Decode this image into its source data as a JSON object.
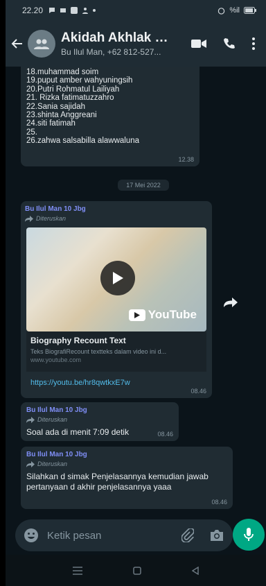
{
  "status_bar": {
    "time": "22.20",
    "signal": "%il"
  },
  "header": {
    "title": "Akidah Akhlak X...",
    "subtitle": "Bu Ilul Man, +62 812-527..."
  },
  "list_message": {
    "lines": [
      "18.muhammad soim",
      "19.puput amber wahyuningsih",
      "20.Putri Rohmatul Lailiyah",
      "21. Rizka fatimatuzzahro",
      "22.Sania sajidah",
      "23.shinta Anggreani",
      "24.siti fatimah",
      "25.",
      "26.zahwa salsabilla alawwaluna"
    ],
    "time": "12.38"
  },
  "date_chip": "17 Mei 2022",
  "messages": [
    {
      "sender": "Bu Ilul Man 10 Jbg",
      "forwarded": "Diteruskan",
      "link": {
        "brand": "YouTube",
        "title": "Biography Recount Text",
        "description": "Teks BiografiRecount textteks dalam video ini d...",
        "domain": "www.youtube.com",
        "url": "https://youtu.be/hr8qwtkxE7w"
      },
      "time": "08.46"
    },
    {
      "sender": "Bu Ilul Man 10 Jbg",
      "forwarded": "Diteruskan",
      "text": "Soal ada di menit 7:09 detik",
      "time": "08.46"
    },
    {
      "sender": "Bu Ilul Man 10 Jbg",
      "forwarded": "Diteruskan",
      "text": "Silahkan d simak Penjelasannya kemudian jawab pertanyaan d akhir penjelasannya yaaa",
      "time": "08.46"
    }
  ],
  "input": {
    "placeholder": "Ketik pesan"
  },
  "colors": {
    "accent": "#00a884",
    "link": "#53bdeb",
    "sender": "#7f8ef5",
    "bubble": "#202c33",
    "background": "#0b141a"
  }
}
